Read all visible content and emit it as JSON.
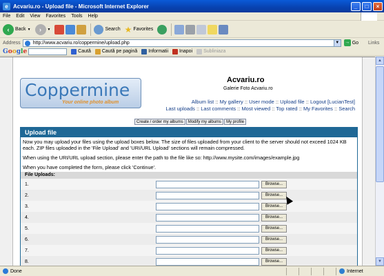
{
  "window": {
    "title": "Acvariu.ro - Upload file - Microsoft Internet Explorer"
  },
  "menu": [
    "File",
    "Edit",
    "View",
    "Favorites",
    "Tools",
    "Help"
  ],
  "toolbar": {
    "back": "Back",
    "search": "Search",
    "favorites": "Favorites"
  },
  "address": {
    "label": "Address",
    "url": "http://www.acvariu.ro/coppermine/upload.php",
    "go": "Go",
    "links": "Links"
  },
  "google_bar": {
    "logo": "Google",
    "items": [
      "Caută",
      "Caută pe pagină",
      "Informatii",
      "Inapoi",
      "Subliniaza"
    ]
  },
  "site": {
    "logo_text": "Coppermine",
    "logo_tagline": "Your online photo album",
    "name": "Acvariu.ro",
    "subtitle": "Galerie Foto Acvariu.ro",
    "nav1": [
      "Album list",
      "My gallery",
      "User mode",
      "Upload file",
      "Logout [LucianTest]"
    ],
    "nav2": [
      "Last uploads",
      "Last comments",
      "Most viewed",
      "Top rated",
      "My Favorites",
      "Search"
    ],
    "tabs": [
      "Create / order my albums",
      "Modify my albums",
      "My profile"
    ]
  },
  "upload": {
    "heading": "Upload file",
    "para1": "Now you may upload your files using the upload boxes below. The size of files uploaded from your client to the server should not exceed 1024 KB each. ZIP files uploaded in the 'File Upload' and 'URI/URL Upload' sections will remain compressed.",
    "para2": "When using the URI/URL upload section, please enter the path to the file like so: http://www.mysite.com/images/example.jpg",
    "para3": "When you have completed the form, please click 'Continue'.",
    "section_label": "File Uploads:",
    "browse_label": "Browse...",
    "rows": [
      "1.",
      "2.",
      "3.",
      "4.",
      "5.",
      "6.",
      "7.",
      "8."
    ]
  },
  "status": {
    "text": "Done",
    "zone": "Internet"
  }
}
